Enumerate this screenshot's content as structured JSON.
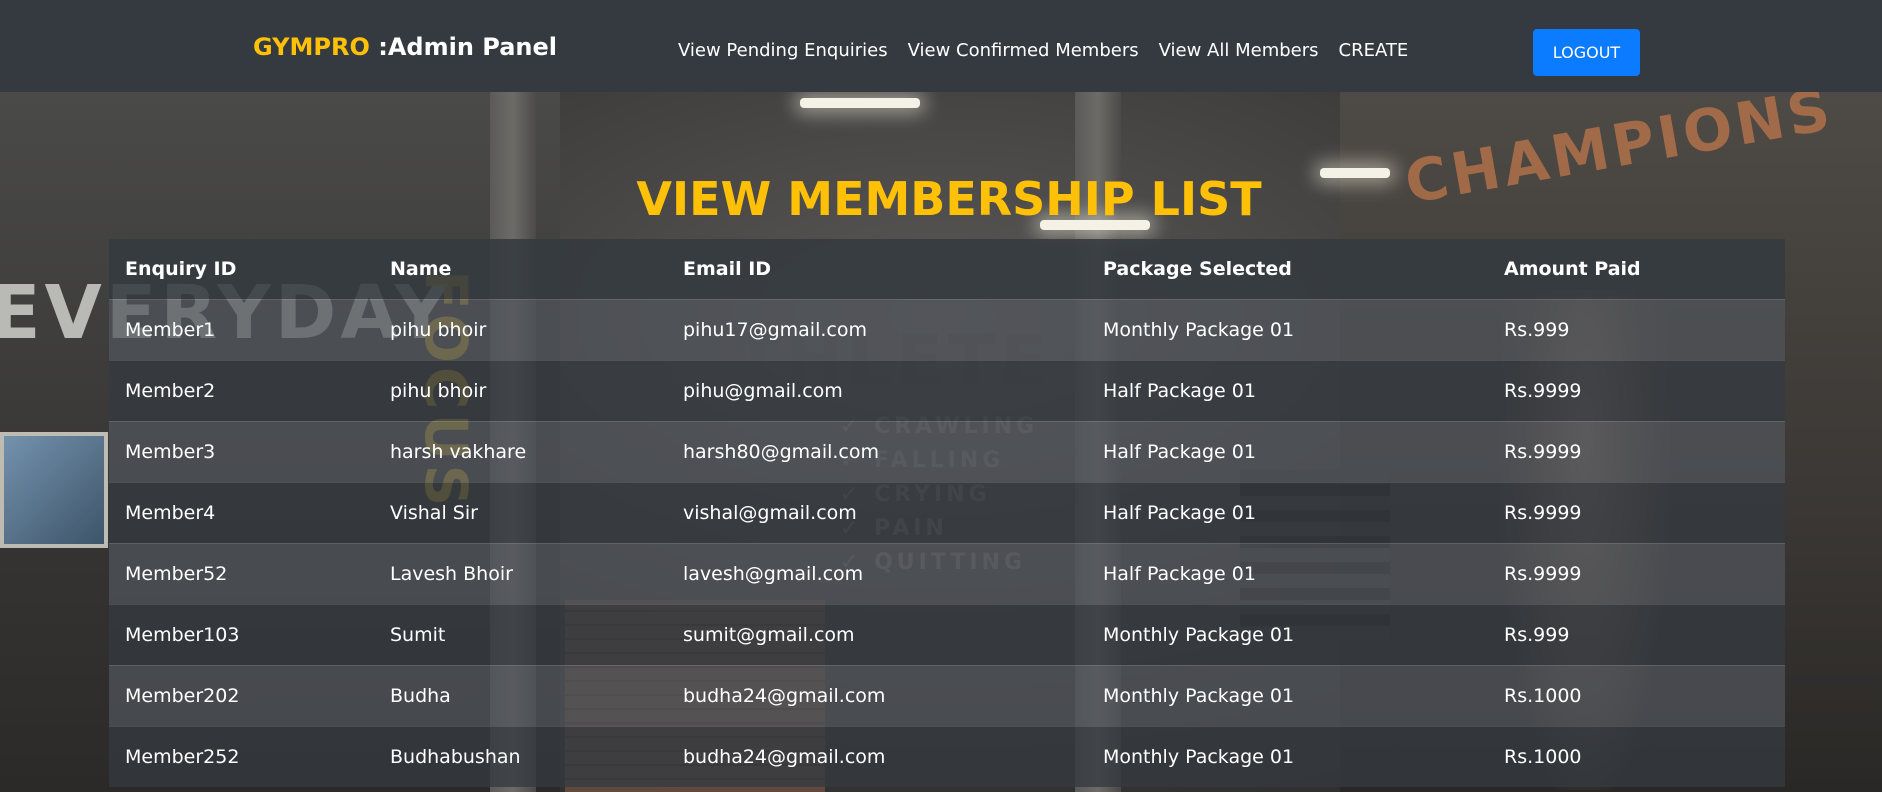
{
  "navbar": {
    "brand_name": "GYMPRO",
    "brand_suffix": " :Admin Panel",
    "links": [
      {
        "label": "View Pending Enquiries"
      },
      {
        "label": "View Confirmed Members"
      },
      {
        "label": "View All Members"
      },
      {
        "label": "CREATE"
      }
    ],
    "logout_label": "LOGOUT"
  },
  "page": {
    "title": "VIEW MEMBERSHIP LIST"
  },
  "table": {
    "headers": [
      "Enquiry ID",
      "Name",
      "Email ID",
      "Package Selected",
      "Amount Paid"
    ],
    "rows": [
      [
        "Member1",
        "pihu bhoir",
        "pihu17@gmail.com",
        "Monthly Package 01",
        "Rs.999"
      ],
      [
        "Member2",
        "pihu bhoir",
        "pihu@gmail.com",
        "Half Package 01",
        "Rs.9999"
      ],
      [
        "Member3",
        "harsh vakhare",
        "harsh80@gmail.com",
        "Half Package 01",
        "Rs.9999"
      ],
      [
        "Member4",
        "Vishal Sir",
        "vishal@gmail.com",
        "Half Package 01",
        "Rs.9999"
      ],
      [
        "Member52",
        "Lavesh Bhoir",
        "lavesh@gmail.com",
        "Half Package 01",
        "Rs.9999"
      ],
      [
        "Member103",
        "Sumit",
        "sumit@gmail.com",
        "Monthly Package 01",
        "Rs.999"
      ],
      [
        "Member202",
        "Budha",
        "budha24@gmail.com",
        "Monthly Package 01",
        "Rs.1000"
      ],
      [
        "Member252",
        "Budhabushan",
        "budha24@gmail.com",
        "Monthly Package 01",
        "Rs.1000"
      ]
    ]
  },
  "background": {
    "texts": [
      "CHAMPIONS",
      "EVERYDAY",
      "ATHLETE",
      "FOCUS"
    ],
    "checklist": [
      "✓ CRAWLING",
      "✓ FALLING",
      "✓ CRYING",
      "✓ PAIN",
      "✓ QUITTING"
    ]
  },
  "colors": {
    "navbar_bg": "#343a40",
    "accent_yellow": "#ffc107",
    "button_blue": "#0b7bff"
  }
}
